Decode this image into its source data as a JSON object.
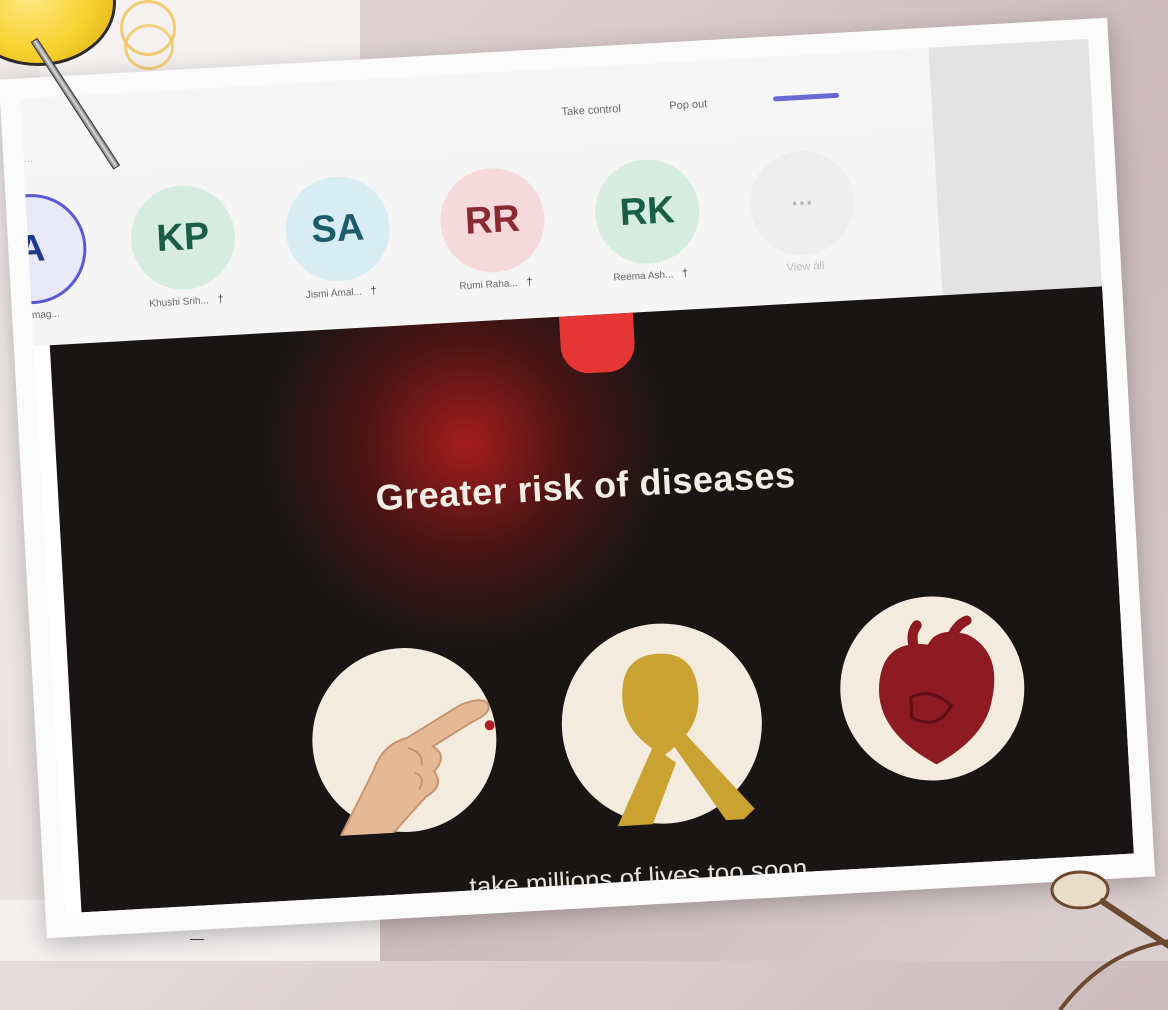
{
  "toolbar": {
    "take_control": "Take control",
    "pop_out": "Pop out",
    "corner_text": "···"
  },
  "participants": [
    {
      "initials": "A",
      "name": "...delmag...",
      "color": "#e9e8f6",
      "ring": "#5b58d3",
      "text_color": "#1f3a8a"
    },
    {
      "initials": "KP",
      "name": "Khushi Srih...",
      "color": "#d6ece1",
      "text_color": "#1b5e48"
    },
    {
      "initials": "SA",
      "name": "Jismi Amal...",
      "color": "#d7edf3",
      "text_color": "#1d5d6b"
    },
    {
      "initials": "RR",
      "name": "Rumi Raha...",
      "color": "#f6d9da",
      "text_color": "#8a2b33"
    },
    {
      "initials": "RK",
      "name": "Reema Ash...",
      "color": "#d6ece1",
      "text_color": "#1b5e48"
    }
  ],
  "view_all": {
    "label": "View all",
    "glyph": "⋯"
  },
  "pin_glyph": "†",
  "slide": {
    "title": "Greater risk of diseases",
    "subtitle": "... take millions of lives too soon"
  },
  "bottom_text": "—"
}
